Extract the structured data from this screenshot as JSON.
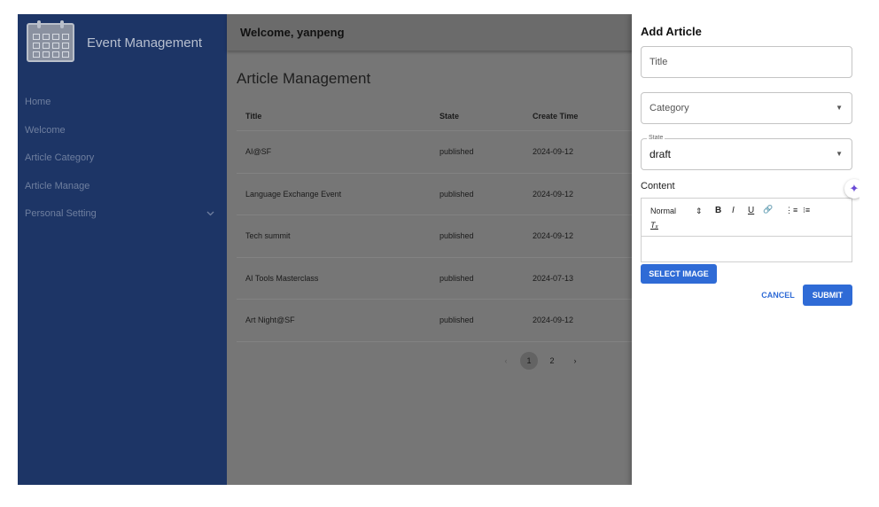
{
  "sidebar": {
    "brand": "Event Management",
    "items": [
      {
        "label": "Home"
      },
      {
        "label": "Welcome"
      },
      {
        "label": "Article Category"
      },
      {
        "label": "Article Manage"
      },
      {
        "label": "Personal Setting",
        "icon": "chevron-down-icon"
      }
    ]
  },
  "header": {
    "welcome": "Welcome, yanpeng"
  },
  "main": {
    "title": "Article Management",
    "columns": [
      "Title",
      "State",
      "Create Time"
    ],
    "rows": [
      {
        "title": "AI@SF",
        "state": "published",
        "created": "2024-09-12"
      },
      {
        "title": "Language Exchange Event",
        "state": "published",
        "created": "2024-09-12"
      },
      {
        "title": "Tech summit",
        "state": "published",
        "created": "2024-09-12"
      },
      {
        "title": "AI Tools Masterclass",
        "state": "published",
        "created": "2024-07-13"
      },
      {
        "title": "Art Night@SF",
        "state": "published",
        "created": "2024-09-12"
      }
    ],
    "pagination": {
      "prev": "‹",
      "pages": [
        "1",
        "2"
      ],
      "next": "›",
      "current": "1"
    }
  },
  "drawer": {
    "title": "Add Article",
    "title_placeholder": "Title",
    "category_placeholder": "Category",
    "state_label": "State",
    "state_value": "draft",
    "content_label": "Content",
    "toolbar": {
      "heading": "Normal",
      "heading_arrow": "⇕",
      "bold": "B",
      "italic": "I",
      "underline": "U",
      "link": "🔗",
      "ordered_list": "⋮≡",
      "bullet_list": "⁝≡",
      "clear": "Tₓ"
    },
    "select_image": "SELECT IMAGE",
    "cancel": "CANCEL",
    "submit": "SUBMIT"
  },
  "sparkle": "✦"
}
